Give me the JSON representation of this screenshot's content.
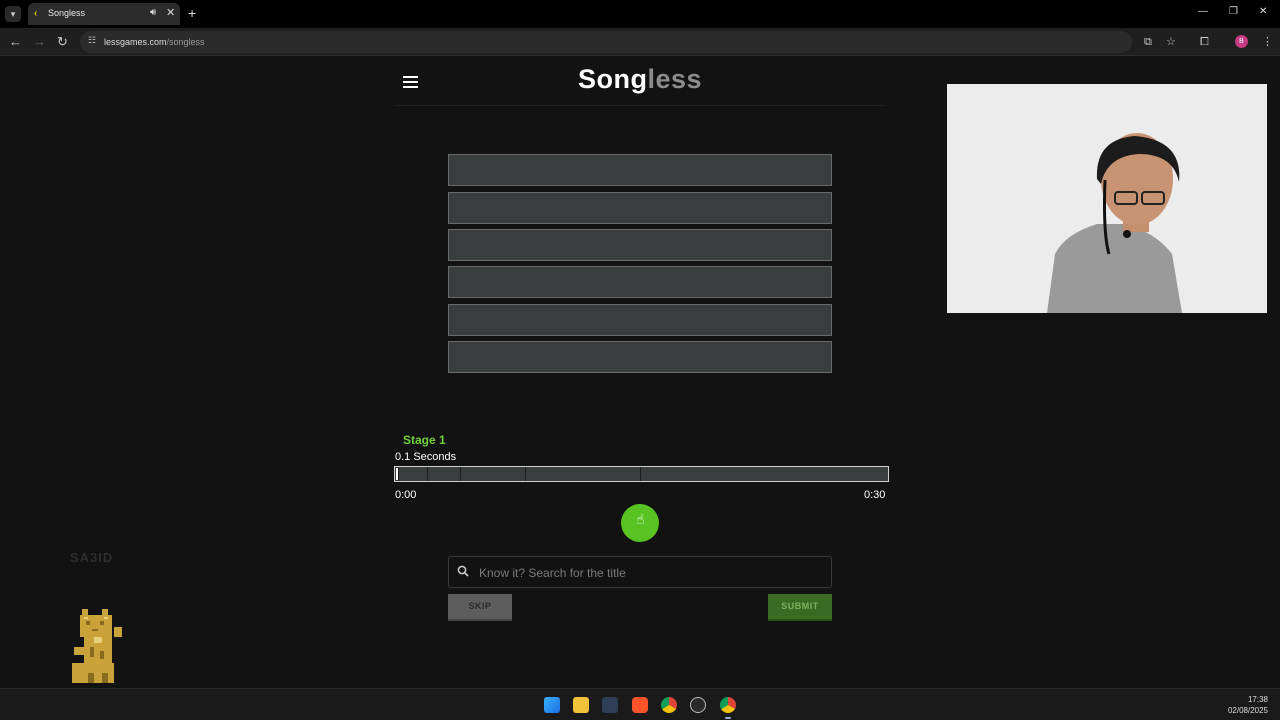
{
  "browser": {
    "tab_title": "Songless",
    "url_domain": "lessgames.com",
    "url_path": "/songless",
    "profile_initial": "B"
  },
  "header": {
    "logo_part1": "Song",
    "logo_part2": "less"
  },
  "guess_slots_count": 6,
  "player": {
    "stage_label": "Stage 1",
    "duration_label": "0.1 Seconds",
    "time_start": "0:00",
    "time_end": "0:30",
    "progress_fraction": 0.0033
  },
  "search": {
    "placeholder": "Know it? Search for the title"
  },
  "buttons": {
    "skip": "SKIP",
    "submit": "SUBMIT"
  },
  "overlay": {
    "watermark": "SA3ID"
  },
  "taskbar": {
    "time": "17:38",
    "date": "02/08/2025"
  },
  "colors": {
    "accent_green": "#58c322",
    "stage_green": "#6fcf3c",
    "slot_bg": "#3a3d3e",
    "page_bg": "#121212"
  }
}
